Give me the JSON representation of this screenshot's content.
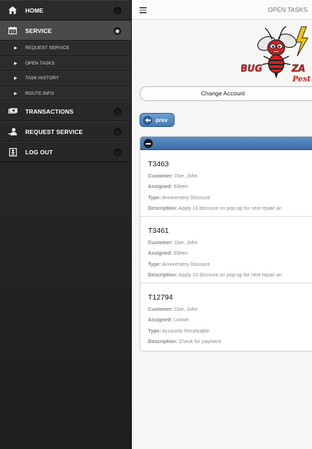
{
  "sidebar": {
    "items": [
      {
        "label": "HOME",
        "icon": "home-icon"
      },
      {
        "label": "SERVICE",
        "icon": "calendar-icon",
        "active": true
      },
      {
        "label": "TRANSACTIONS",
        "icon": "money-icon"
      },
      {
        "label": "REQUEST SERVICE",
        "icon": "person-request-icon"
      },
      {
        "label": "LOG OUT",
        "icon": "logout-icon"
      }
    ],
    "service_subitems": [
      "REQUEST SERVICE",
      "OPEN TASKS",
      "TASK HISTORY",
      "ROUTE INFO"
    ]
  },
  "header": {
    "title": "OPEN TASKS"
  },
  "logo": {
    "word1": "BUG",
    "word2": "ZA",
    "word3": "Pest"
  },
  "change_account_label": "Change Account",
  "prev_label": "prev",
  "labels": {
    "customer": "Customer:",
    "assigned": "Assigned:",
    "type": "Type:",
    "description": "Description:"
  },
  "tasks": [
    {
      "id": "T3463",
      "customer": "Doe, John",
      "assigned": "Eileen",
      "type": "Anniversery Discount",
      "description": "Apply 10 discount on pop-up for next repair an"
    },
    {
      "id": "T3461",
      "customer": "Doe, John",
      "assigned": "Eileen",
      "type": "Anniversery Discount",
      "description": "Apply 10 discount on pop-up for next repair an"
    },
    {
      "id": "T12794",
      "customer": "Doe, John",
      "assigned": "Lonnie",
      "type": "Accounts Receivable",
      "description": "Check for payment"
    }
  ],
  "colors": {
    "sidebar_bg": "#262628",
    "accent_blue": "#4a7ab4",
    "logo_red": "#d6201f",
    "logo_yellow": "#f5c400"
  }
}
